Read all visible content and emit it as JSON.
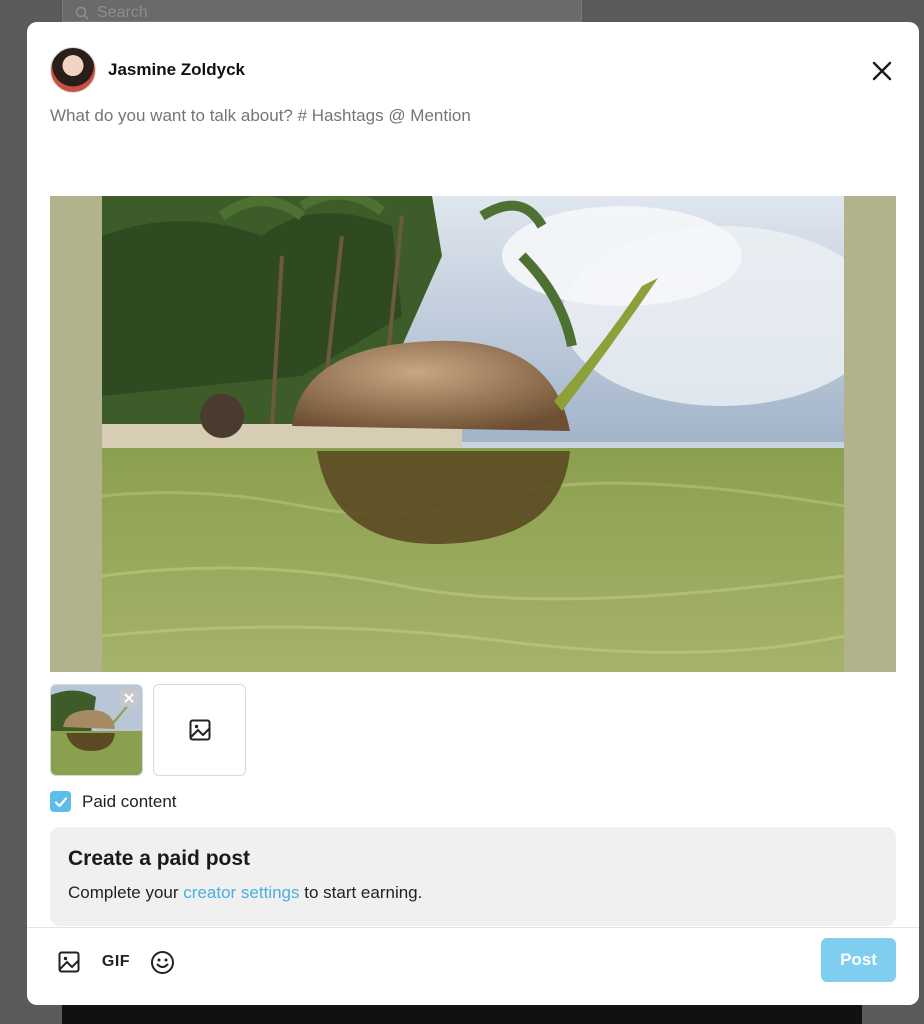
{
  "background": {
    "search_placeholder": "Search"
  },
  "post_modal": {
    "user": {
      "name": "Jasmine Zoldyck"
    },
    "composer": {
      "placeholder": "What do you want to talk about? # Hashtags @ Mention"
    },
    "paid_content": {
      "label": "Paid content",
      "checked": true
    },
    "paid_post_box": {
      "title": "Create a paid post",
      "desc_prefix": "Complete your ",
      "link_text": "creator settings",
      "desc_suffix": " to start earning."
    },
    "toolbar": {
      "gif_label": "GIF",
      "post_label": "Post"
    }
  },
  "colors": {
    "accent": "#5cbde8",
    "post_button": "#7fcdef",
    "link": "#4aaee0",
    "image_letterbox": "#b2b38c"
  }
}
